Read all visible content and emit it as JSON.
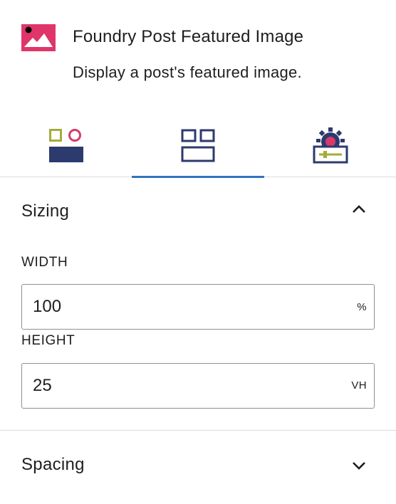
{
  "block": {
    "icon": "featured-image-icon",
    "title": "Foundry Post Featured Image",
    "description": "Display a post's featured image."
  },
  "tabs": [
    {
      "name": "style",
      "icon": "style-icon",
      "active": false
    },
    {
      "name": "layout",
      "icon": "layout-icon",
      "active": true
    },
    {
      "name": "advanced",
      "icon": "settings-icon",
      "active": false
    }
  ],
  "sizing": {
    "title": "Sizing",
    "expanded": true,
    "width_label": "WIDTH",
    "width_value": "100",
    "width_unit": "%",
    "height_label": "HEIGHT",
    "height_value": "25",
    "height_unit": "VH"
  },
  "spacing": {
    "title": "Spacing",
    "expanded": false
  },
  "colors": {
    "accent": "#3174c0",
    "image_icon": "#e0356a",
    "navy": "#2c3a6e",
    "olive": "#a3ad3a",
    "pink": "#d83a6a"
  }
}
